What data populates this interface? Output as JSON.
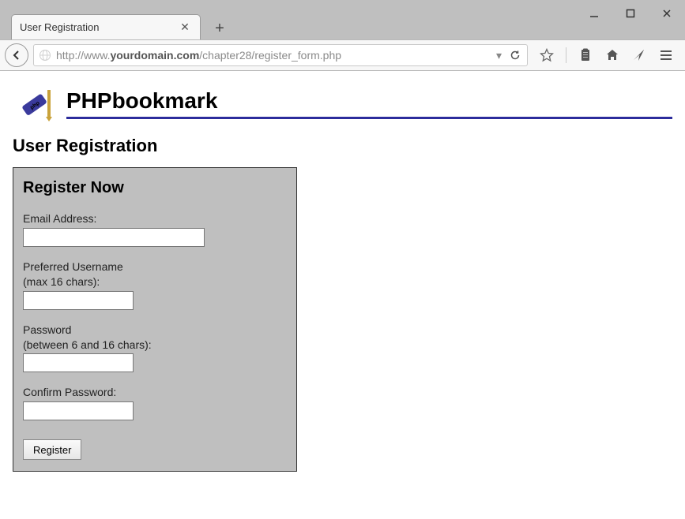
{
  "window": {
    "tab_title": "User Registration",
    "url_prefix": "http://www.",
    "url_domain": "yourdomain.com",
    "url_path": "/chapter28/register_form.php"
  },
  "site": {
    "title": "PHPbookmark"
  },
  "page": {
    "heading": "User Registration"
  },
  "form": {
    "title": "Register Now",
    "email_label": "Email Address:",
    "email_value": "",
    "username_label_line1": "Preferred Username",
    "username_label_line2": "(max 16 chars):",
    "username_value": "",
    "password_label_line1": "Password",
    "password_label_line2": "(between 6 and 16 chars):",
    "password_value": "",
    "confirm_label": "Confirm Password:",
    "confirm_value": "",
    "submit_label": "Register"
  }
}
